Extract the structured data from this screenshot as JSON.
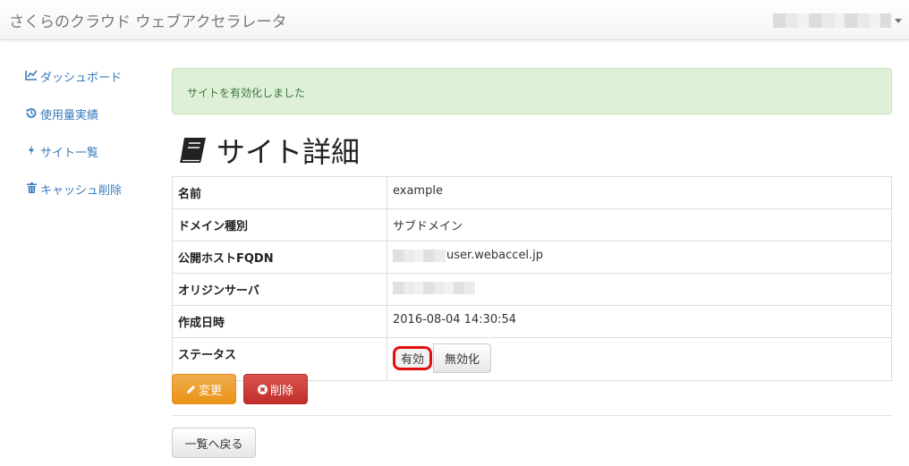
{
  "app": {
    "brand": "さくらのクラウド ウェブアクセラレータ"
  },
  "sidebar": {
    "items": [
      {
        "label": "ダッシュボード",
        "icon": "chart-line-icon"
      },
      {
        "label": "使用量実績",
        "icon": "history-icon"
      },
      {
        "label": "サイト一覧",
        "icon": "bolt-icon"
      },
      {
        "label": "キャッシュ削除",
        "icon": "trash-icon"
      }
    ]
  },
  "alert": {
    "message": "サイトを有効化しました"
  },
  "page": {
    "title": "サイト詳細",
    "icon": "book-icon"
  },
  "details": {
    "rows": [
      {
        "key": "名前",
        "value": "example"
      },
      {
        "key": "ドメイン種別",
        "value": "サブドメイン"
      },
      {
        "key": "公開ホストFQDN",
        "value": "user.webaccel.jp"
      },
      {
        "key": "オリジンサーバ",
        "value": ""
      },
      {
        "key": "作成日時",
        "value": "2016-08-04 14:30:54"
      }
    ],
    "status": {
      "key": "ステータス",
      "on_label": "有効",
      "off_label": "無効化"
    }
  },
  "actions": {
    "edit_label": "変更",
    "delete_label": "削除",
    "back_label": "一覧へ戻る"
  },
  "colors": {
    "link": "#3a7bbd",
    "success_bg": "#dff0d8",
    "warning": "#f0ad4e",
    "danger": "#d9534f",
    "highlight": "#e01010"
  }
}
